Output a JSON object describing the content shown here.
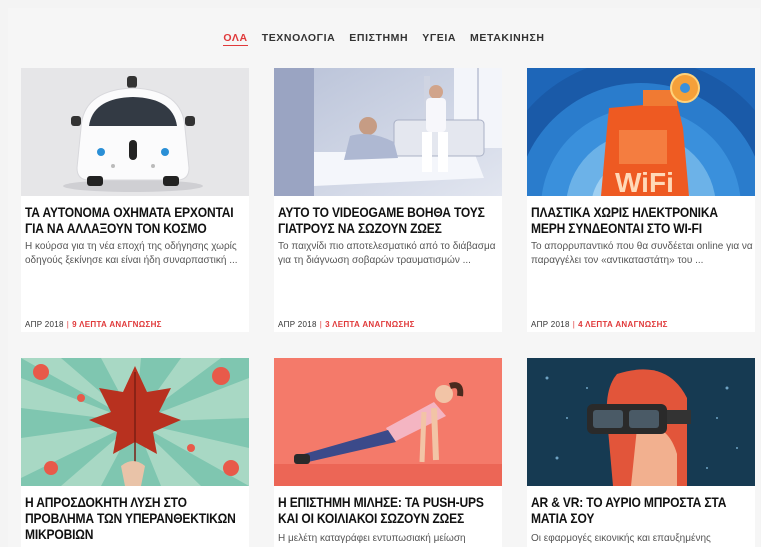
{
  "nav": {
    "items": [
      {
        "label": "ΟΛΑ",
        "active": true
      },
      {
        "label": "ΤΕΧΝΟΛΟΓΙΑ",
        "active": false
      },
      {
        "label": "ΕΠΙΣΤΗΜΗ",
        "active": false
      },
      {
        "label": "ΥΓΕΙΑ",
        "active": false
      },
      {
        "label": "ΜΕΤΑΚΙΝΗΣΗ",
        "active": false
      }
    ]
  },
  "colors": {
    "accent": "#e0393a",
    "text": "#111111",
    "muted": "#555555",
    "background": "#f6f6f6"
  },
  "articles": [
    {
      "image": "self-driving-car-illustration",
      "title": "ΤΑ ΑΥΤΟΝΟΜΑ ΟΧΗΜΑΤΑ ΕΡΧΟΝΤΑΙ ΓΙΑ ΝΑ ΑΛΛΑΞΟΥΝ ΤΟΝ ΚΟΣΜΟ",
      "excerpt": "Η κούρσα για τη νέα εποχή της οδήγησης χωρίς οδηγούς ξεκίνησε και είναι ήδη συναρπαστική ...",
      "date": "ΑΠΡ 2018",
      "read_time": "9 ΛΕΠΤΑ ΑΝΑΓΝΩΣΗΣ"
    },
    {
      "image": "hospital-room-photo",
      "title": "ΑΥΤΟ ΤΟ VIDEOGAME ΒΟΗΘΑ ΤΟΥΣ ΓΙΑΤΡΟΥΣ ΝΑ ΣΩΖΟΥΝ ΖΩΕΣ",
      "excerpt": "Το παιχνίδι πιο αποτελεσματικό από το διάβασμα για τη διάγνωση σοβαρών τραυματισμών ...",
      "date": "ΑΠΡ 2018",
      "read_time": "3 ΛΕΠΤΑ ΑΝΑΓΝΩΣΗΣ"
    },
    {
      "image": "wifi-detergent-bottle-illustration",
      "title": "ΠΛΑΣΤΙΚΑ ΧΩΡΙΣ ΗΛΕΚΤΡΟΝΙΚΑ ΜΕΡΗ ΣΥΝΔΕΟΝΤΑΙ ΣΤΟ WI-FI",
      "excerpt": "Το απορρυπαντικό που θα συνδέεται online για να παραγγέλει τον «αντικαταστάτη» του ...",
      "date": "ΑΠΡ 2018",
      "read_time": "4 ΛΕΠΤΑ ΑΝΑΓΝΩΣΗΣ"
    },
    {
      "image": "autumn-leaf-illustration",
      "title": "Η ΑΠΡΟΣΔΟΚΗΤΗ ΛΥΣΗ ΣΤΟ ΠΡΟΒΛΗΜΑ ΤΩΝ ΥΠΕΡΑΝΘΕΚΤΙΚΩΝ ΜΙΚΡΟΒΙΩΝ",
      "excerpt": "",
      "date": "",
      "read_time": ""
    },
    {
      "image": "push-up-woman-illustration",
      "title": "Η ΕΠΙΣΤΗΜΗ ΜΙΛΗΣΕ: ΤΑ PUSH-UPS ΚΑΙ ΟΙ ΚΟΙΛΙΑΚΟΙ ΣΩΖΟΥΝ ΖΩΕΣ",
      "excerpt": "Η μελέτη καταγράφει εντυπωσιακή μείωση",
      "date": "",
      "read_time": ""
    },
    {
      "image": "vr-headset-illustration",
      "title": "AR & VR: ΤΟ ΑΥΡΙΟ ΜΠΡΟΣΤΑ ΣΤΑ ΜΑΤΙΑ ΣΟΥ",
      "excerpt": "Οι εφαρμογές εικονικής και επαυξημένης",
      "date": "",
      "read_time": ""
    }
  ]
}
